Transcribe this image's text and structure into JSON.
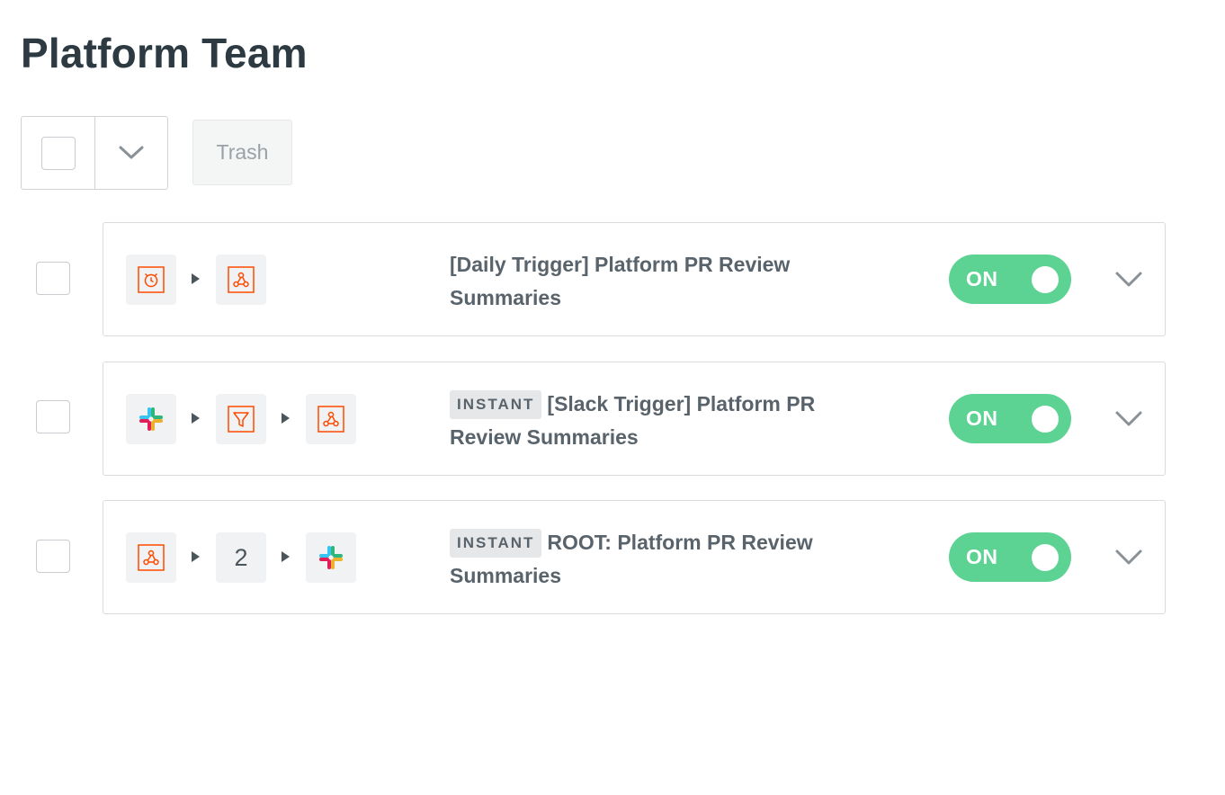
{
  "page": {
    "title": "Platform Team"
  },
  "toolbar": {
    "trash_label": "Trash"
  },
  "colors": {
    "accent_orange": "#ff4a00",
    "toggle_on": "#5dd393",
    "slack_blue": "#36c5f0",
    "slack_green": "#2eb67d",
    "slack_yellow": "#ecb22e",
    "slack_red": "#e01e5a"
  },
  "zaps": [
    {
      "badge": "",
      "title": "[Daily Trigger] Platform PR Review Summaries",
      "status": "ON",
      "steps": [
        {
          "icon": "schedule-icon"
        },
        {
          "icon": "webhook-icon"
        }
      ]
    },
    {
      "badge": "INSTANT",
      "title": "[Slack Trigger] Platform PR Review Summaries",
      "status": "ON",
      "steps": [
        {
          "icon": "slack-icon"
        },
        {
          "icon": "filter-icon"
        },
        {
          "icon": "webhook-icon"
        }
      ]
    },
    {
      "badge": "INSTANT",
      "title": "ROOT: Platform PR Review Summaries",
      "status": "ON",
      "steps": [
        {
          "icon": "webhook-icon"
        },
        {
          "count": "2"
        },
        {
          "icon": "slack-icon"
        }
      ]
    }
  ]
}
